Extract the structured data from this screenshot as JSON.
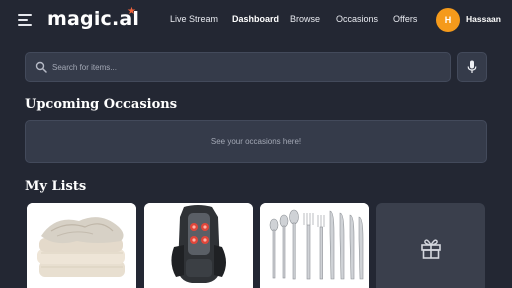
{
  "header": {
    "logo": "magic.al",
    "nav": [
      {
        "label": "Live Stream",
        "active": false
      },
      {
        "label": "Dashboard",
        "active": true
      },
      {
        "label": "Browse",
        "active": false
      },
      {
        "label": "Occasions",
        "active": false
      },
      {
        "label": "Offers",
        "active": false
      }
    ],
    "user": {
      "initial": "H",
      "name": "Hassaan"
    }
  },
  "search": {
    "placeholder": "Search for items..."
  },
  "occasions": {
    "title": "Upcoming Occasions",
    "empty_text": "See your occasions here!"
  },
  "lists": {
    "title": "My Lists",
    "items": [
      {
        "image": "folded-blankets"
      },
      {
        "image": "back-massager"
      },
      {
        "image": "cutlery-set"
      },
      {
        "image": "gift-icon"
      }
    ]
  },
  "colors": {
    "background": "#232733",
    "surface": "#353b4a",
    "accent": "#f59a1b",
    "logo_star": "#f0643c"
  }
}
